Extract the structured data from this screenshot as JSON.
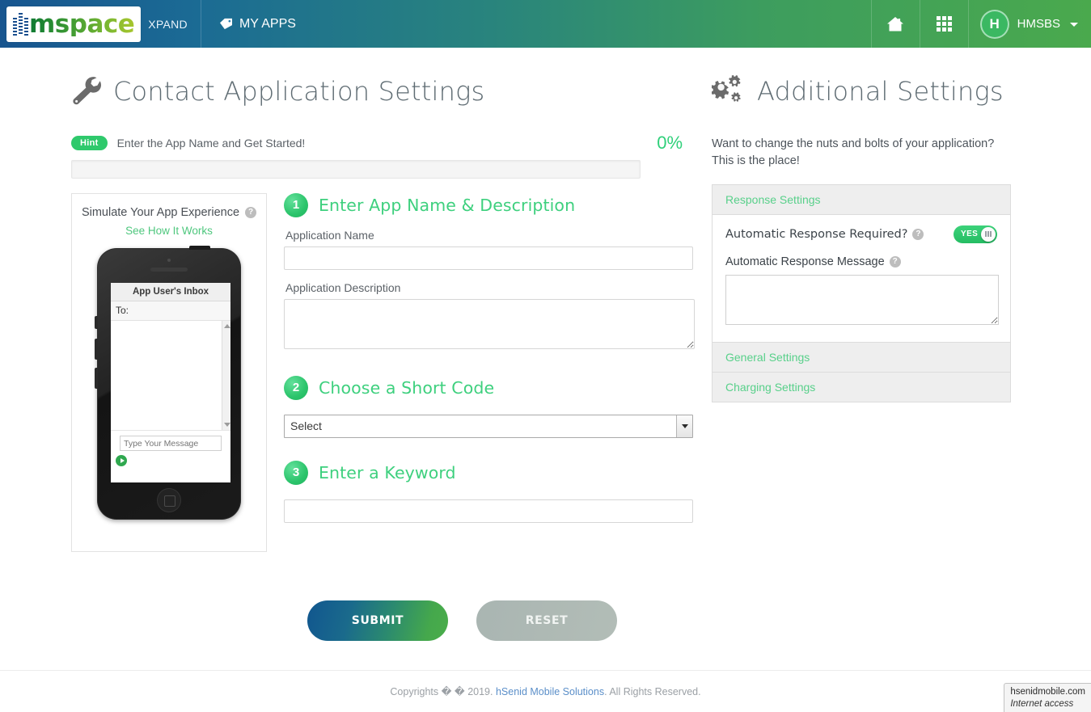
{
  "nav": {
    "brand_logo_text": "mspace",
    "brand_sub": "XPAND",
    "my_apps": "MY APPS",
    "home_icon": "home-icon",
    "grid_icon": "grid-apps-icon",
    "avatar_initial": "H",
    "user_name": "HMSBS",
    "gradient_from": "#18558f",
    "gradient_to": "#4aa94d"
  },
  "left": {
    "title": "Contact Application Settings",
    "title_icon": "wrench-icon",
    "hint_badge": "Hint",
    "hint_text": "Enter the App Name and Get Started!",
    "progress_pct_label": "0%",
    "progress_value": 0,
    "accent_green": "#2fc96c"
  },
  "simulator": {
    "card_title": "Simulate Your App Experience",
    "help_icon": "help-icon",
    "help_glyph": "?",
    "link": "See How It Works",
    "inbox_title": "App User's Inbox",
    "to_label": "To:",
    "message_placeholder": "Type Your Message",
    "message_value": "",
    "send_icon": "send-arrow-icon"
  },
  "steps": [
    {
      "num": "1",
      "title": "Enter App Name & Description",
      "name_label": "Application Name",
      "name_value": "",
      "desc_label": "Application Description",
      "desc_value": ""
    },
    {
      "num": "2",
      "title": "Choose a Short Code",
      "select_value": "Select",
      "select_options": [
        "Select"
      ]
    },
    {
      "num": "3",
      "title": "Enter a Keyword",
      "keyword_value": ""
    }
  ],
  "buttons": {
    "submit": "SUBMIT",
    "reset": "RESET"
  },
  "right": {
    "title": "Additional Settings",
    "title_icon": "gears-icon",
    "description": "Want to change the nuts and bolts of your application? This is the place!",
    "accordion": [
      {
        "label": "Response Settings",
        "expanded": true,
        "fields": {
          "auto_response_required_label": "Automatic Response Required?",
          "auto_response_required_help": "?",
          "toggle_state": "YES",
          "auto_response_message_label": "Automatic Response Message",
          "auto_response_message_help": "?",
          "auto_response_message_value": ""
        }
      },
      {
        "label": "General Settings",
        "expanded": false
      },
      {
        "label": "Charging Settings",
        "expanded": false
      }
    ]
  },
  "footer": {
    "copyright_pre": "Copyrights � � 2019.",
    "link": "hSenid Mobile Solutions",
    "copyright_post": ". All Rights Reserved."
  },
  "status_tip": {
    "url": "hsenidmobile.com",
    "sub": "Internet access"
  }
}
